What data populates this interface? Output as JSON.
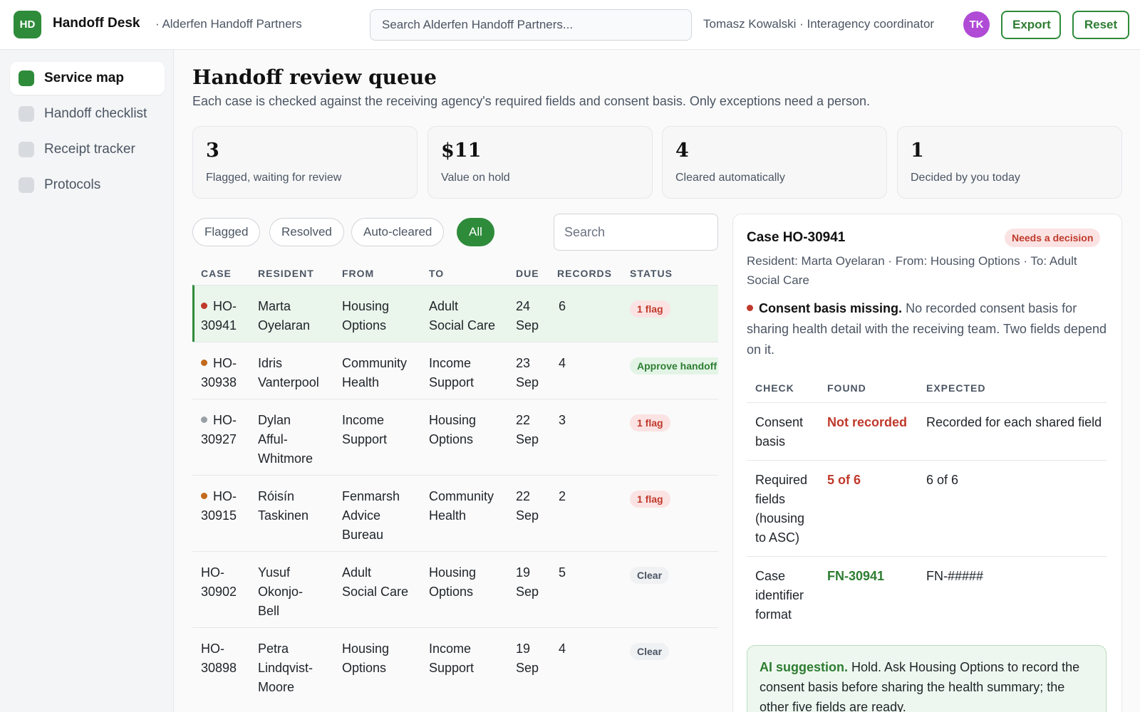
{
  "header": {
    "logo": "HD",
    "app_title": "Handoff Desk",
    "org": "· Alderfen Handoff Partners",
    "search_placeholder": "Search Alderfen Handoff Partners...",
    "user": "Tomasz Kowalski · Interagency coordinator",
    "avatar": "TK",
    "export_label": "Export",
    "reset_label": "Reset"
  },
  "sidebar": {
    "items": [
      {
        "label": "Service map",
        "active": true
      },
      {
        "label": "Handoff checklist",
        "active": false
      },
      {
        "label": "Receipt tracker",
        "active": false
      },
      {
        "label": "Protocols",
        "active": false
      }
    ]
  },
  "page": {
    "title": "Handoff review queue",
    "subtitle": "Each case is checked against the receiving agency's required fields and consent basis. Only exceptions need a person."
  },
  "stats": [
    {
      "value": "3",
      "label": "Flagged, waiting for review"
    },
    {
      "value": "$11",
      "label": "Value on hold"
    },
    {
      "value": "4",
      "label": "Cleared automatically"
    },
    {
      "value": "1",
      "label": "Decided by you today"
    }
  ],
  "filters": {
    "chips": [
      {
        "label": "Flagged",
        "active": false
      },
      {
        "label": "Resolved",
        "active": false
      },
      {
        "label": "Auto-cleared",
        "active": false
      },
      {
        "label": "All",
        "active": true
      }
    ],
    "search_placeholder": "Search"
  },
  "table": {
    "headers": [
      "CASE",
      "RESIDENT",
      "FROM",
      "TO",
      "DUE",
      "RECORDS",
      "STATUS"
    ],
    "rows": [
      {
        "case1": "HO-",
        "case2": "30941",
        "res": [
          "Marta",
          "Oyelaran"
        ],
        "from": [
          "Housing",
          "Options"
        ],
        "to": [
          "Adult",
          "Social Care"
        ],
        "due": [
          "24",
          "Sep"
        ],
        "records": "6",
        "status": "1 flag",
        "status_kind": "flag",
        "dot": "#c0392b"
      },
      {
        "case1": "HO-",
        "case2": "30938",
        "res": [
          "Idris",
          "Vanterpool"
        ],
        "from": [
          "Community",
          "Health"
        ],
        "to": [
          "Income",
          "Support"
        ],
        "due": [
          "23",
          "Sep"
        ],
        "records": "4",
        "status": "Approve handoff",
        "status_kind": "approve",
        "dot": "#c26a1d"
      },
      {
        "case1": "HO-",
        "case2": "30927",
        "res": [
          "Dylan",
          "Afful-",
          "Whitmore"
        ],
        "from": [
          "Income",
          "Support"
        ],
        "to": [
          "Housing",
          "Options"
        ],
        "due": [
          "22",
          "Sep"
        ],
        "records": "3",
        "status": "1 flag",
        "status_kind": "flag",
        "dot": "#9aa0a8"
      },
      {
        "case1": "HO-",
        "case2": "30915",
        "res": [
          "Róisín",
          "Taskinen"
        ],
        "from": [
          "Fenmarsh",
          "Advice",
          "Bureau"
        ],
        "to": [
          "Community",
          "Health"
        ],
        "due": [
          "22",
          "Sep"
        ],
        "records": "2",
        "status": "1 flag",
        "status_kind": "flag",
        "dot": "#c26a1d"
      },
      {
        "case1": "HO-",
        "case2": "30902",
        "res": [
          "Yusuf",
          "Okonjo-",
          "Bell"
        ],
        "from": [
          "Adult",
          "Social Care"
        ],
        "to": [
          "Housing",
          "Options"
        ],
        "due": [
          "19",
          "Sep"
        ],
        "records": "5",
        "status": "Clear",
        "status_kind": "clear",
        "dot": ""
      },
      {
        "case1": "HO-",
        "case2": "30898",
        "res": [
          "Petra",
          "Lindqvist-",
          "Moore"
        ],
        "from": [
          "Housing",
          "Options"
        ],
        "to": [
          "Income",
          "Support"
        ],
        "due": [
          "19",
          "Sep"
        ],
        "records": "4",
        "status": "Clear",
        "status_kind": "clear",
        "dot": ""
      }
    ]
  },
  "detail": {
    "title": "Case HO-30941",
    "badge": "Needs a decision",
    "meta": "Resident: Marta Oyelaran · From: Housing Options · To: Adult Social Care",
    "issue_title": "Consent basis missing.",
    "issue_text": " No recorded consent basis for sharing health detail with the receiving team. Two fields depend on it.",
    "headers": [
      "CHECK",
      "FOUND",
      "EXPECTED"
    ],
    "checks": [
      {
        "check": [
          "Consent",
          "basis"
        ],
        "found": "Not recorded",
        "found_kind": "bad",
        "expected": "Recorded for each shared field"
      },
      {
        "check": [
          "Required",
          "fields",
          "(housing",
          "to ASC)"
        ],
        "found": "5 of 6",
        "found_kind": "bad",
        "expected": "6 of 6"
      },
      {
        "check": [
          "Case",
          "identifier",
          "format"
        ],
        "found": "FN-30941",
        "found_kind": "good",
        "expected": "FN-#####"
      }
    ],
    "ai_label": "AI suggestion.",
    "ai_text": " Hold. Ask Housing Options to record the consent basis before sharing the health summary; the other five fields are ready."
  },
  "colors": {
    "accent": "#2e8b3a",
    "danger": "#c0392b",
    "avatar": "#b04bd6"
  }
}
